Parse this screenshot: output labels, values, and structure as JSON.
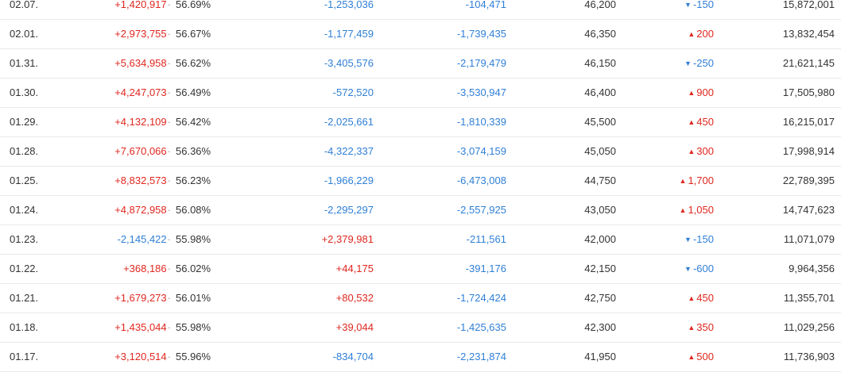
{
  "colors": {
    "up": "#e0271f",
    "down": "#2f7fd6"
  },
  "rows": [
    {
      "date": "02.07.",
      "foreign": "+1,420,917",
      "foreign_dir": "up",
      "ratio": "56.69%",
      "inst": "-1,253,036",
      "inst_dir": "down",
      "indiv": "-104,471",
      "indiv_dir": "down",
      "close": "46,200",
      "change": "-150",
      "change_dir": "down",
      "volume": "15,872,001"
    },
    {
      "date": "02.01.",
      "foreign": "+2,973,755",
      "foreign_dir": "up",
      "ratio": "56.67%",
      "inst": "-1,177,459",
      "inst_dir": "down",
      "indiv": "-1,739,435",
      "indiv_dir": "down",
      "close": "46,350",
      "change": "200",
      "change_dir": "up",
      "volume": "13,832,454"
    },
    {
      "date": "01.31.",
      "foreign": "+5,634,958",
      "foreign_dir": "up",
      "ratio": "56.62%",
      "inst": "-3,405,576",
      "inst_dir": "down",
      "indiv": "-2,179,479",
      "indiv_dir": "down",
      "close": "46,150",
      "change": "-250",
      "change_dir": "down",
      "volume": "21,621,145"
    },
    {
      "date": "01.30.",
      "foreign": "+4,247,073",
      "foreign_dir": "up",
      "ratio": "56.49%",
      "inst": "-572,520",
      "inst_dir": "down",
      "indiv": "-3,530,947",
      "indiv_dir": "down",
      "close": "46,400",
      "change": "900",
      "change_dir": "up",
      "volume": "17,505,980"
    },
    {
      "date": "01.29.",
      "foreign": "+4,132,109",
      "foreign_dir": "up",
      "ratio": "56.42%",
      "inst": "-2,025,661",
      "inst_dir": "down",
      "indiv": "-1,810,339",
      "indiv_dir": "down",
      "close": "45,500",
      "change": "450",
      "change_dir": "up",
      "volume": "16,215,017"
    },
    {
      "date": "01.28.",
      "foreign": "+7,670,066",
      "foreign_dir": "up",
      "ratio": "56.36%",
      "inst": "-4,322,337",
      "inst_dir": "down",
      "indiv": "-3,074,159",
      "indiv_dir": "down",
      "close": "45,050",
      "change": "300",
      "change_dir": "up",
      "volume": "17,998,914"
    },
    {
      "date": "01.25.",
      "foreign": "+8,832,573",
      "foreign_dir": "up",
      "ratio": "56.23%",
      "inst": "-1,966,229",
      "inst_dir": "down",
      "indiv": "-6,473,008",
      "indiv_dir": "down",
      "close": "44,750",
      "change": "1,700",
      "change_dir": "up",
      "volume": "22,789,395"
    },
    {
      "date": "01.24.",
      "foreign": "+4,872,958",
      "foreign_dir": "up",
      "ratio": "56.08%",
      "inst": "-2,295,297",
      "inst_dir": "down",
      "indiv": "-2,557,925",
      "indiv_dir": "down",
      "close": "43,050",
      "change": "1,050",
      "change_dir": "up",
      "volume": "14,747,623"
    },
    {
      "date": "01.23.",
      "foreign": "-2,145,422",
      "foreign_dir": "down",
      "ratio": "55.98%",
      "inst": "+2,379,981",
      "inst_dir": "up",
      "indiv": "-211,561",
      "indiv_dir": "down",
      "close": "42,000",
      "change": "-150",
      "change_dir": "down",
      "volume": "11,071,079"
    },
    {
      "date": "01.22.",
      "foreign": "+368,186",
      "foreign_dir": "up",
      "ratio": "56.02%",
      "inst": "+44,175",
      "inst_dir": "up",
      "indiv": "-391,176",
      "indiv_dir": "down",
      "close": "42,150",
      "change": "-600",
      "change_dir": "down",
      "volume": "9,964,356"
    },
    {
      "date": "01.21.",
      "foreign": "+1,679,273",
      "foreign_dir": "up",
      "ratio": "56.01%",
      "inst": "+80,532",
      "inst_dir": "up",
      "indiv": "-1,724,424",
      "indiv_dir": "down",
      "close": "42,750",
      "change": "450",
      "change_dir": "up",
      "volume": "11,355,701"
    },
    {
      "date": "01.18.",
      "foreign": "+1,435,044",
      "foreign_dir": "up",
      "ratio": "55.98%",
      "inst": "+39,044",
      "inst_dir": "up",
      "indiv": "-1,425,635",
      "indiv_dir": "down",
      "close": "42,300",
      "change": "350",
      "change_dir": "up",
      "volume": "11,029,256"
    },
    {
      "date": "01.17.",
      "foreign": "+3,120,514",
      "foreign_dir": "up",
      "ratio": "55.96%",
      "inst": "-834,704",
      "inst_dir": "down",
      "indiv": "-2,231,874",
      "indiv_dir": "down",
      "close": "41,950",
      "change": "500",
      "change_dir": "up",
      "volume": "11,736,903"
    }
  ]
}
